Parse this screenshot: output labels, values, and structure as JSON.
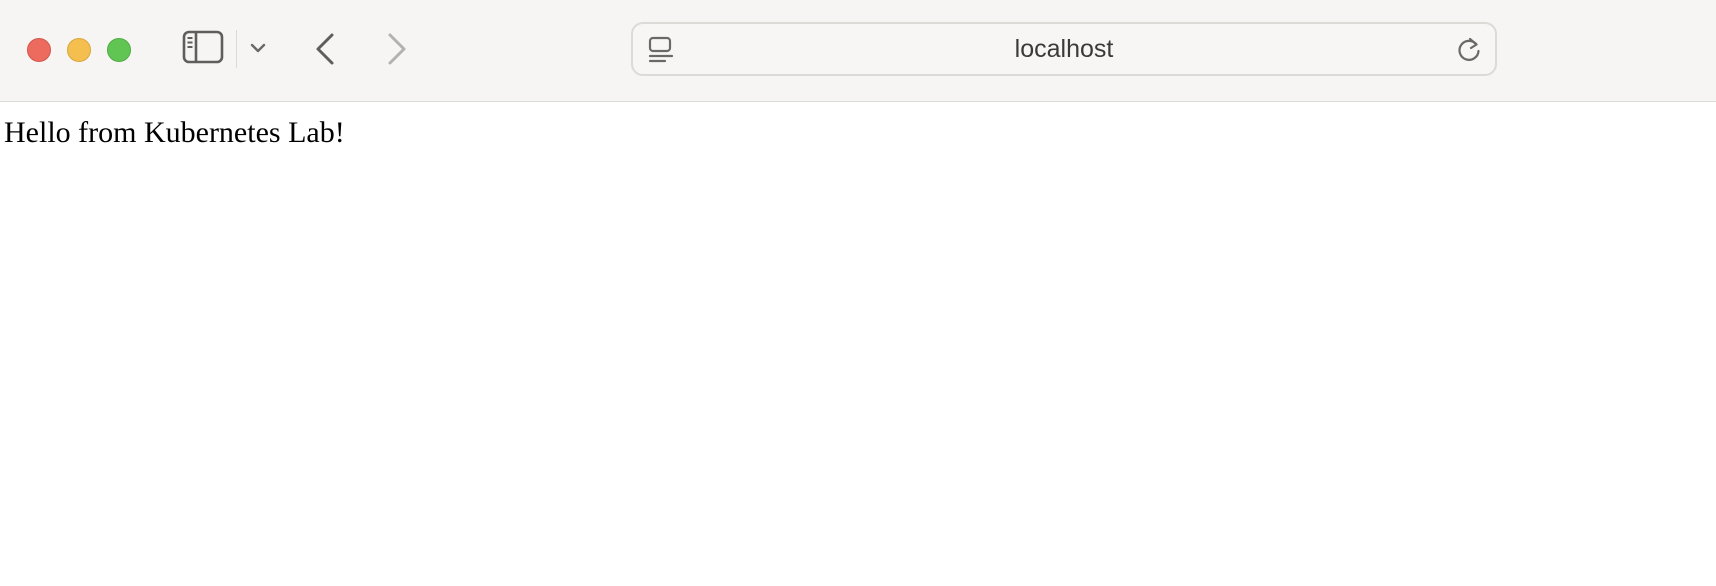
{
  "browser": {
    "colors": {
      "close": "#ec6a5e",
      "minimize": "#f4bf4f",
      "maximize": "#61c554",
      "toolbar_bg": "#f6f5f3"
    },
    "icons": {
      "sidebar": "sidebar-icon",
      "dropdown": "chevron-down-icon",
      "back": "chevron-left-icon",
      "forward": "chevron-right-icon",
      "page_menu": "page-menu-icon",
      "reload": "reload-icon"
    },
    "address_bar": {
      "url": "localhost"
    }
  },
  "page": {
    "body_text": "Hello from Kubernetes Lab!"
  }
}
